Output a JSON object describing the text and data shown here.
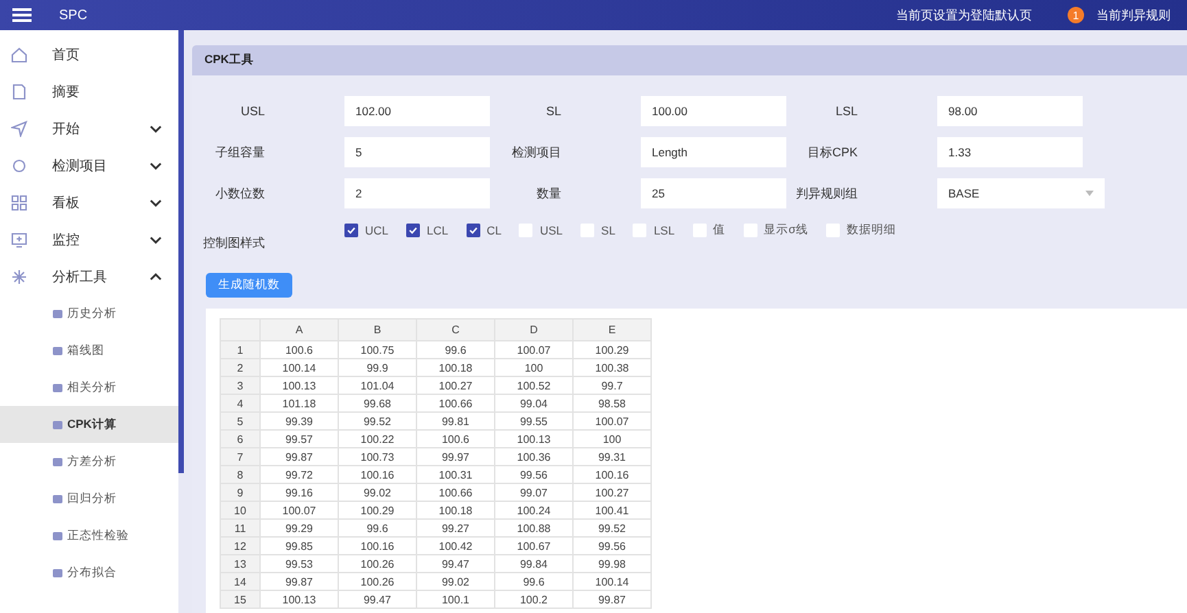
{
  "header": {
    "title": "SPC",
    "default_page_link": "当前页设置为登陆默认页",
    "badge": "1",
    "rules_link": "当前判异规则"
  },
  "sidebar": {
    "items": [
      {
        "label": "首页"
      },
      {
        "label": "摘要"
      },
      {
        "label": "开始",
        "expanded": false
      },
      {
        "label": "检测项目",
        "expanded": false
      },
      {
        "label": "看板",
        "expanded": false
      },
      {
        "label": "监控",
        "expanded": false
      },
      {
        "label": "分析工具",
        "expanded": true,
        "children": [
          {
            "label": "历史分析",
            "selected": false
          },
          {
            "label": "箱线图",
            "selected": false
          },
          {
            "label": "相关分析",
            "selected": false
          },
          {
            "label": "CPK计算",
            "selected": true
          },
          {
            "label": "方差分析",
            "selected": false
          },
          {
            "label": "回归分析",
            "selected": false
          },
          {
            "label": "正态性检验",
            "selected": false
          },
          {
            "label": "分布拟合",
            "selected": false
          }
        ]
      }
    ]
  },
  "card": {
    "title": "CPK工具",
    "fields": [
      {
        "label": "USL",
        "kind": "input",
        "value": "102.00"
      },
      {
        "label": "SL",
        "kind": "input",
        "value": "100.00"
      },
      {
        "label": "LSL",
        "kind": "input",
        "value": "98.00"
      },
      {
        "label": "子组容量",
        "kind": "input",
        "value": "5"
      },
      {
        "label": "检测项目",
        "kind": "input",
        "value": "Length"
      },
      {
        "label": "目标CPK",
        "kind": "input",
        "value": "1.33"
      },
      {
        "label": "小数位数",
        "kind": "input",
        "value": "2"
      },
      {
        "label": "数量",
        "kind": "input",
        "value": "25"
      },
      {
        "label": "判异规则组",
        "kind": "select",
        "value": "BASE"
      }
    ],
    "chart_style_label": "控制图样式",
    "chart_style_options": [
      {
        "label": "UCL",
        "checked": true
      },
      {
        "label": "LCL",
        "checked": true
      },
      {
        "label": "CL",
        "checked": true
      },
      {
        "label": "USL",
        "checked": false
      },
      {
        "label": "SL",
        "checked": false
      },
      {
        "label": "LSL",
        "checked": false
      },
      {
        "label": "值",
        "checked": false
      },
      {
        "label": "显示σ线",
        "checked": false
      },
      {
        "label": "数据明细",
        "checked": false
      }
    ],
    "generate_button": "生成随机数"
  },
  "table": {
    "columns": [
      "A",
      "B",
      "C",
      "D",
      "E"
    ],
    "rows": [
      {
        "index": "1",
        "values": [
          "100.6",
          "100.75",
          "99.6",
          "100.07",
          "100.29"
        ]
      },
      {
        "index": "2",
        "values": [
          "100.14",
          "99.9",
          "100.18",
          "100",
          "100.38"
        ]
      },
      {
        "index": "3",
        "values": [
          "100.13",
          "101.04",
          "100.27",
          "100.52",
          "99.7"
        ]
      },
      {
        "index": "4",
        "values": [
          "101.18",
          "99.68",
          "100.66",
          "99.04",
          "98.58"
        ]
      },
      {
        "index": "5",
        "values": [
          "99.39",
          "99.52",
          "99.81",
          "99.55",
          "100.07"
        ]
      },
      {
        "index": "6",
        "values": [
          "99.57",
          "100.22",
          "100.6",
          "100.13",
          "100"
        ]
      },
      {
        "index": "7",
        "values": [
          "99.87",
          "100.73",
          "99.97",
          "100.36",
          "99.31"
        ]
      },
      {
        "index": "8",
        "values": [
          "99.72",
          "100.16",
          "100.31",
          "99.56",
          "100.16"
        ]
      },
      {
        "index": "9",
        "values": [
          "99.16",
          "99.02",
          "100.66",
          "99.07",
          "100.27"
        ]
      },
      {
        "index": "10",
        "values": [
          "100.07",
          "100.29",
          "100.18",
          "100.24",
          "100.41"
        ]
      },
      {
        "index": "11",
        "values": [
          "99.29",
          "99.6",
          "99.27",
          "100.88",
          "99.52"
        ]
      },
      {
        "index": "12",
        "values": [
          "99.85",
          "100.16",
          "100.42",
          "100.67",
          "99.56"
        ]
      },
      {
        "index": "13",
        "values": [
          "99.53",
          "100.26",
          "99.47",
          "99.84",
          "99.98"
        ]
      },
      {
        "index": "14",
        "values": [
          "99.87",
          "100.26",
          "99.02",
          "99.6",
          "100.14"
        ]
      },
      {
        "index": "15",
        "values": [
          "100.13",
          "99.47",
          "100.1",
          "100.2",
          "99.87"
        ]
      }
    ]
  }
}
